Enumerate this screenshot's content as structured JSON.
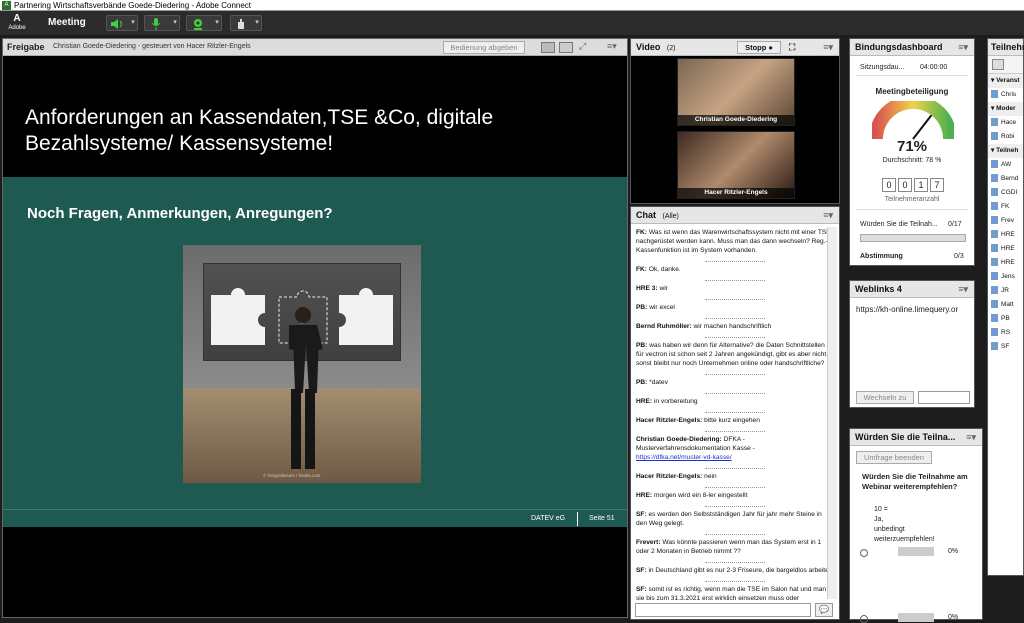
{
  "window": {
    "title": "Partnering Wirtschaftsverbände Goede-Diedering - Adobe Connect"
  },
  "menubar": {
    "brand": "Adobe",
    "meeting_label": "Meeting"
  },
  "share": {
    "pod_title": "Freigabe",
    "presenter_info": "Christian Goede-Diedering - gesteuert von Hacer Ritzler-Engels",
    "stop_button": "Bedienung abgeben",
    "slide_title": "Anforderungen an Kassendaten,TSE &Co, digitale Bezahlsysteme/ Kassensysteme!",
    "slide_subtitle": "Noch Fragen, Anmerkungen, Anregungen?",
    "photo_credit": "© fotografiesam / fotolia.com",
    "footer_company": "DATEV eG",
    "footer_page": "Seite 51"
  },
  "video": {
    "pod_title": "Video",
    "count": "(2)",
    "stop_label": "Stopp",
    "participants": [
      {
        "name": "Christian Goede-Diedering"
      },
      {
        "name": "Hacer Ritzler-Engels"
      }
    ]
  },
  "chat": {
    "pod_title": "Chat",
    "audience": "(Alle)",
    "messages": [
      {
        "sender": "FK:",
        "text": "Was ist wenn das Warenwirtschaftssystem nicht mit einer TSE nachgerüstet werden kann. Muss man das dann wechseln? Reg.-Kassenfunktion ist im System vorhanden."
      },
      {
        "sender": "FK:",
        "text": "Ok, danke."
      },
      {
        "sender": "HRE 3:",
        "text": "wir"
      },
      {
        "sender": "PB:",
        "text": "wir excel"
      },
      {
        "sender": "Bernd Ruhmöller:",
        "text": "wir machen handschriftlich"
      },
      {
        "sender": "PB:",
        "text": "was haben wir denn für Alternative? die Daten Schnittstellen für vectron ist schon seit 2 Jahren angekündigt, gibt es aber nicht. sonst bleibt nur noch Unternehmen online oder handschriftliche?"
      },
      {
        "sender": "PB:",
        "text": "*datev"
      },
      {
        "sender": "HRE:",
        "text": "in vorbereitung"
      },
      {
        "sender": "Hacer Ritzler-Engels:",
        "text": "bitte kurz eingehen"
      },
      {
        "sender": "Christian Goede-Diedering:",
        "text": "DFKA - Musterverfahrensdokumentation Kasse -",
        "link": "https://dfka.net/muster-vd-kasse/"
      },
      {
        "sender": "Hacer Ritzler-Engels:",
        "text": "nein"
      },
      {
        "sender": "HRE:",
        "text": "morgen wird ein 8-ler eingestellt"
      },
      {
        "sender": "SF:",
        "text": "es werden den Selbstständigen Jahr für jahr mehr Steine in den  Weg gelegt."
      },
      {
        "sender": "Frevert:",
        "text": "Was könnte passieren wenn man das System erst in 1 oder 2 Monaten in Betrieb nimmt ??"
      },
      {
        "sender": "SF:",
        "text": "in Deutschland gibt es nur 2-3 Friseure, die bargeldlos arbeiten"
      },
      {
        "sender": "SF:",
        "text": "somit ist es richtig, wenn man die TSE im Salon hat und man sie bis zum 31.3.2021 erst wirklich einsetzen muss oder"
      }
    ]
  },
  "dashboard": {
    "pod_title": "Bindungsdashboard",
    "session_label": "Sitzungsdau...",
    "session_value": "04:00:00",
    "meter_title": "Meetingbeteiligung",
    "percent": "71%",
    "average": "Durchschnitt: 78 %",
    "digits": [
      "0",
      "0",
      "1",
      "7"
    ],
    "count_label": "Teilnehmeranzahl",
    "question_label": "Würden Sie die Teilnah...",
    "question_value": "0/17",
    "vote_label": "Abstimmung",
    "vote_value": "0/3",
    "meter_fraction": 0.71
  },
  "weblinks": {
    "pod_title": "Weblinks 4",
    "url": "https://kh-online.limequery.or",
    "button": "Wechseln zu"
  },
  "poll": {
    "pod_title": "Würden Sie die Teilna...",
    "end_button": "Umfrage beenden",
    "question": "Würden Sie die Teilnahme am Webinar weiterempfehlen?",
    "options": [
      {
        "label": "10 = Ja, unbedingt weiterzuempfehlen!",
        "percent": "0%"
      },
      {
        "label": "",
        "percent": "0%"
      }
    ]
  },
  "attendees": {
    "pod_title": "Teilnehmer",
    "sections": [
      "Veranst",
      "Moder",
      "Teilneh"
    ],
    "hosts": [
      "Chris"
    ],
    "presenters": [
      "Hace",
      "Robi"
    ],
    "participants": [
      "AW",
      "Bernd",
      "CGDI",
      "FK",
      "Frev",
      "HRE",
      "HRE",
      "HRE",
      "Jens",
      "JR",
      "Matt",
      "PB",
      "RS",
      "SF"
    ]
  },
  "colors": {
    "slide_green": "#1f5a52",
    "gauge_red": "#d9534f",
    "gauge_green": "#4caf50"
  }
}
